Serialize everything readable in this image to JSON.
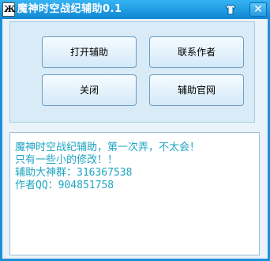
{
  "window": {
    "title": "魔神时空战纪辅助0.1",
    "app_icon_glyph": "Ж",
    "close_glyph": "✕",
    "skin_icon": "tshirt-icon"
  },
  "buttons": {
    "open": "打开辅助",
    "contact": "联系作者",
    "close": "关闭",
    "website": "辅助官网"
  },
  "info": {
    "lines": [
      "魔神时空战纪辅助，第一次弄，不太会！",
      "只有一些小的修改！！",
      "辅助大神群：316367538",
      "作者QQ：904851758"
    ]
  },
  "colors": {
    "title_bar": "#1c8fd6",
    "info_text": "#1ea5c3"
  }
}
